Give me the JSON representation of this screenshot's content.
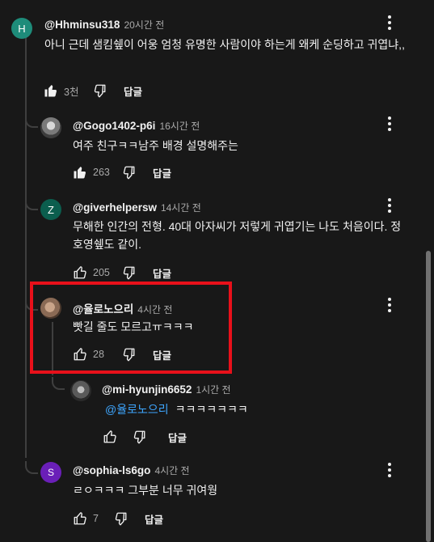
{
  "colors": {
    "background": "#181818",
    "text": "#f1f1f1",
    "secondary_text": "#aaaaaa",
    "mention": "#3ea6ff",
    "highlight_box": "#e8101a"
  },
  "comments": [
    {
      "avatar_letter": "H",
      "avatar_color": "#1e8c7a",
      "author": "@Hhminsu318",
      "time": "20시간 전",
      "text": "아니 근데 샘킴쉪이 어웅 엄청 유명한 사람이야 하는게 왜케 순딩하고 귀엽냐,,",
      "likes": "3천",
      "reply_label": "답글"
    },
    {
      "avatar_letter": "",
      "avatar_color": "#6e6e6e",
      "author": "@Gogo1402-p6i",
      "time": "16시간 전",
      "text": "여주 친구ㅋㅋ남주 배경 설명해주는",
      "likes": "263",
      "reply_label": "답글"
    },
    {
      "avatar_letter": "Z",
      "avatar_color": "#0b5e4e",
      "author": "@giverhelpersw",
      "time": "14시간 전",
      "text": "무해한 인간의 전형. 40대 아자씨가 저렇게 귀엽기는 나도 처음이다. 정호영쉪도 같이.",
      "likes": "205",
      "reply_label": "답글"
    },
    {
      "avatar_letter": "",
      "avatar_color": "#8a6a55",
      "author": "@율로노으리",
      "time": "4시간 전",
      "text": "빳길 줄도 모르고ㅠㅋㅋㅋ",
      "likes": "28",
      "reply_label": "답글"
    },
    {
      "avatar_letter": "",
      "avatar_color": "#5a5a5a",
      "author": "@mi-hyunjin6652",
      "time": "1시간 전",
      "mention": "@율로노으리",
      "text": "ㅋㅋㅋㅋㅋㅋㅋ",
      "likes": "",
      "reply_label": "답글"
    },
    {
      "avatar_letter": "S",
      "avatar_color": "#6a1fb8",
      "author": "@sophia-ls6go",
      "time": "4시간 전",
      "text": "ㄹㅇㅋㅋㅋ 그부분 너무 귀여웡",
      "likes": "7",
      "reply_label": "답글"
    }
  ]
}
